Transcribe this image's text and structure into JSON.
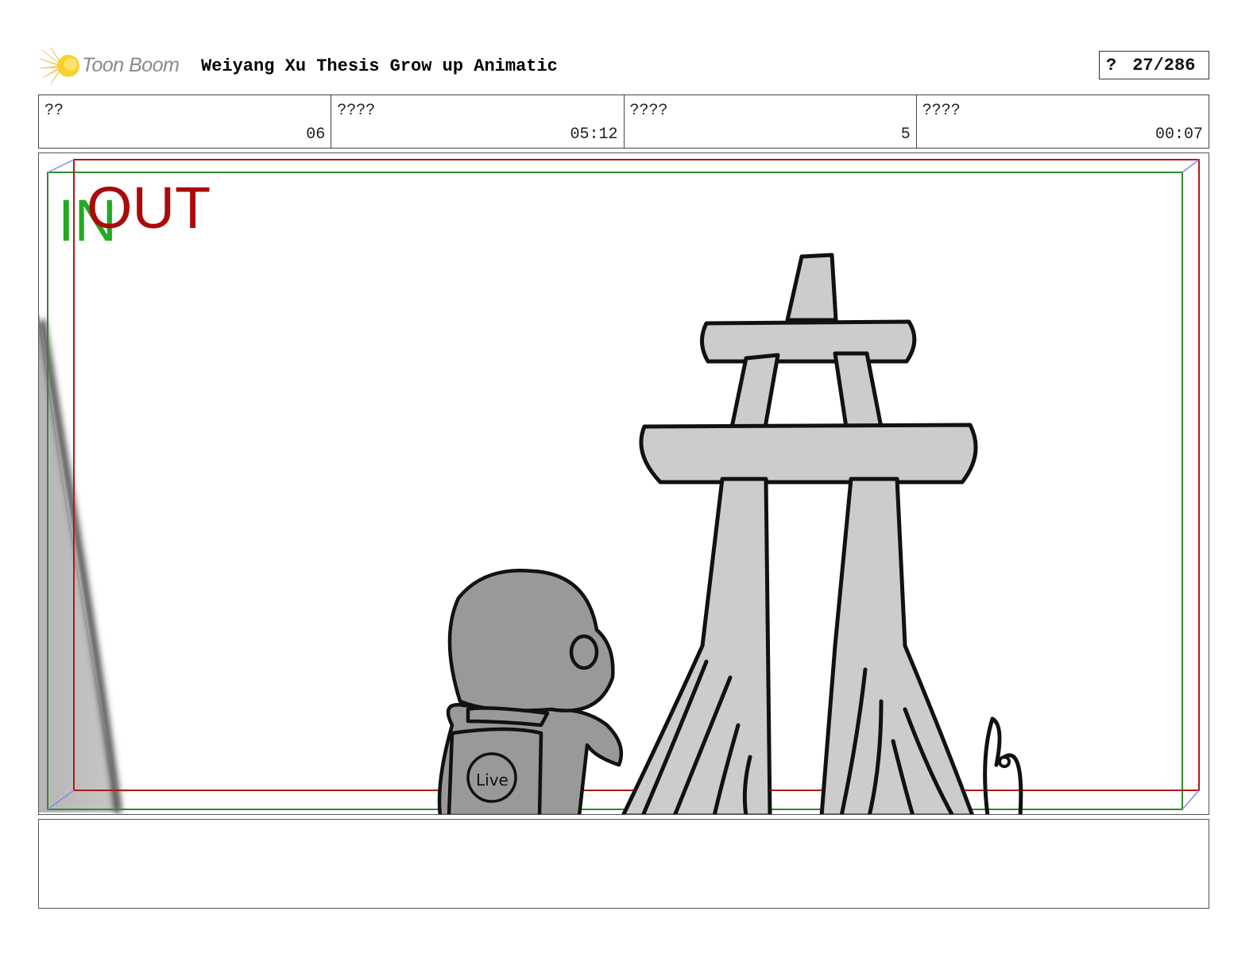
{
  "header": {
    "logo_text": "Toon Boom",
    "project_title": "Weiyang Xu Thesis Grow up Animatic",
    "page_mark": "?",
    "page_counter": "27/286"
  },
  "info": [
    {
      "label": "??",
      "value": "06"
    },
    {
      "label": "????",
      "value": "05:12"
    },
    {
      "label": "????",
      "value": "5"
    },
    {
      "label": "????",
      "value": "00:07"
    }
  ],
  "panel": {
    "in_label": "IN",
    "out_label": "OUT",
    "backpack_text": "Live",
    "colors": {
      "in_frame": "#2e8b2e",
      "out_frame": "#b01818",
      "in_text": "#22aa22",
      "out_text": "#aa0a0a",
      "fill_gray": "#cccccc",
      "character_gray": "#999999"
    }
  },
  "caption": {
    "text": ""
  }
}
